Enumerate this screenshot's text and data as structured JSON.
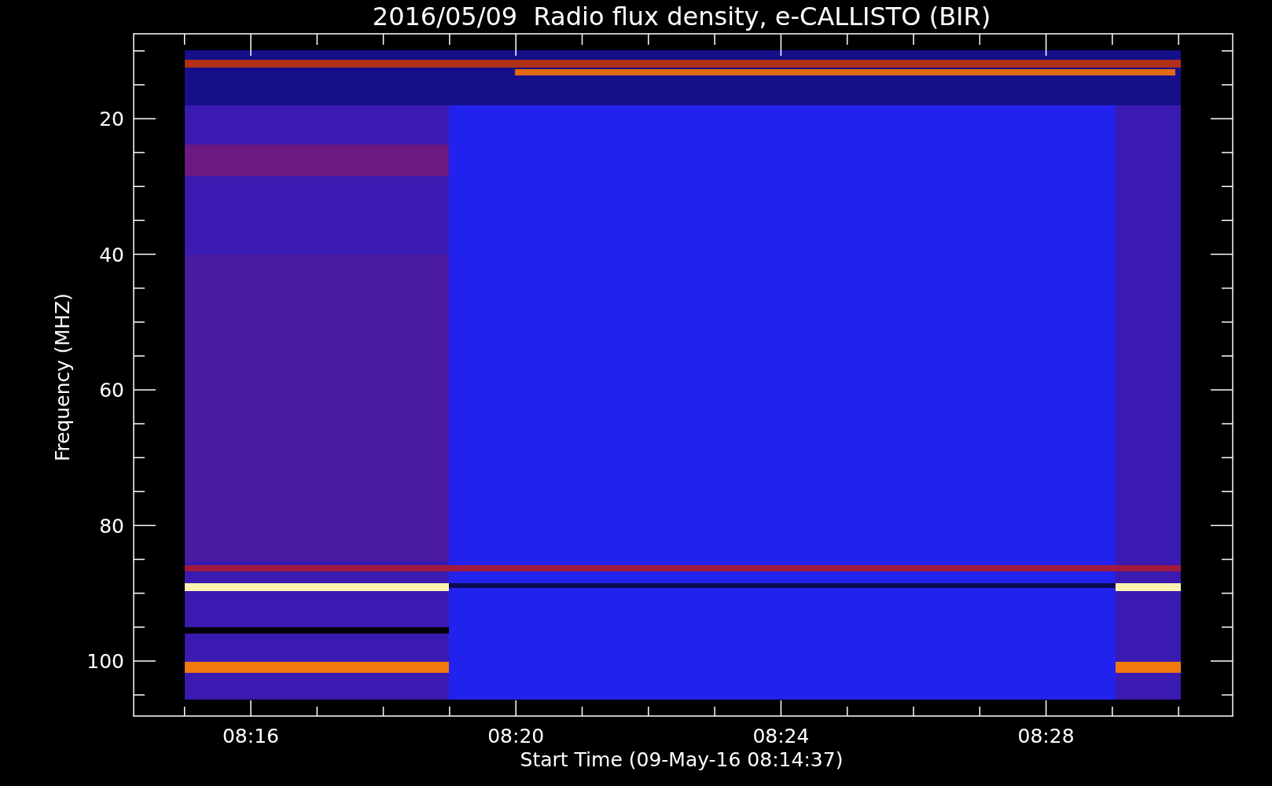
{
  "title": "2016/05/09  Radio flux density, e-CALLISTO (BIR)",
  "y_axis": {
    "label": "Frequency (MHZ)",
    "ticks": [
      "20",
      "40",
      "60",
      "80",
      "100"
    ]
  },
  "x_axis": {
    "label": "Start Time (09-May-16 08:14:37)",
    "ticks": [
      "08:16",
      "08:20",
      "08:24",
      "08:28"
    ]
  }
}
